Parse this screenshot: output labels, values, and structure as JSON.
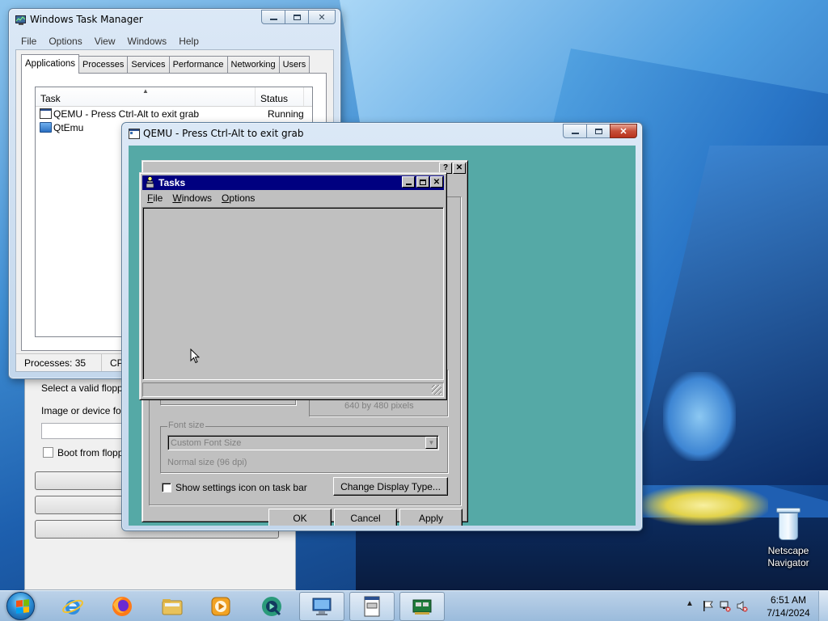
{
  "desktop": {
    "icons": [
      {
        "label": "Netscape Navigator"
      }
    ]
  },
  "task_manager": {
    "title": "Windows Task Manager",
    "menu": [
      "File",
      "Options",
      "View",
      "Windows",
      "Help"
    ],
    "tabs": [
      "Applications",
      "Processes",
      "Services",
      "Performance",
      "Networking",
      "Users"
    ],
    "active_tab": "Applications",
    "columns": [
      "Task",
      "Status"
    ],
    "rows": [
      {
        "task": "QEMU - Press Ctrl-Alt to exit grab",
        "status": "Running"
      },
      {
        "task": "QtEmu",
        "status": ""
      }
    ],
    "status_bar": {
      "processes": "Processes: 35",
      "cpu": "CPU"
    }
  },
  "qtemu": {
    "floppy_label": "Select a valid floppy",
    "image_label": "Image or device for t",
    "boot_floppy_label": "Boot from floppy"
  },
  "qemu": {
    "title": "QEMU - Press Ctrl-Alt to exit grab",
    "display_dialog": {
      "resolution_text": "640 by 480 pixels",
      "font_size_label": "Font size",
      "font_size_value": "Custom Font Size",
      "font_size_note": "Normal size (96 dpi)",
      "show_settings_label": "Show settings icon on task bar",
      "change_display_label": "Change Display Type...",
      "ok_label": "OK",
      "cancel_label": "Cancel",
      "apply_label": "Apply",
      "palette_colors": [
        "#ff00ff",
        "#ffffff",
        "#ff0000",
        "#ffff00",
        "#00ff00",
        "#00ffff",
        "#0000ff",
        "#ff00ff",
        "#000000",
        "#808080",
        "#800000",
        "#808000",
        "#008000",
        "#008080",
        "#000080",
        "#800080"
      ]
    },
    "tasks_window": {
      "title": "Tasks",
      "menu": [
        {
          "accel": "F",
          "rest": "ile"
        },
        {
          "accel": "W",
          "rest": "indows"
        },
        {
          "accel": "O",
          "rest": "ptions"
        }
      ]
    }
  },
  "taskbar": {
    "pinned": [
      "internet-explorer",
      "firefox",
      "file-explorer",
      "media-player",
      "qtemu"
    ],
    "running": [
      "task-manager",
      "qemu",
      "qtemu-app"
    ],
    "clock_time": "6:51 AM",
    "clock_date": "7/14/2024"
  }
}
